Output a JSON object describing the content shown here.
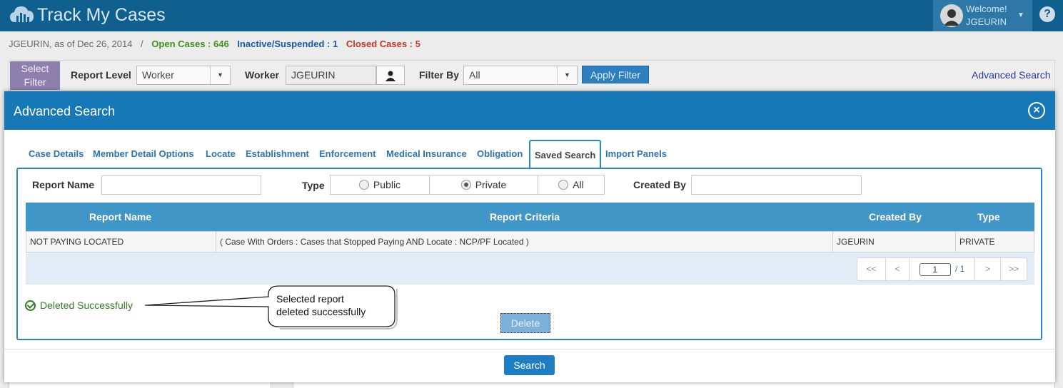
{
  "app": {
    "title": "Track My Cases"
  },
  "user": {
    "welcome": "Welcome!",
    "name": "JGEURIN"
  },
  "help_label": "?",
  "status_bar": {
    "prefix": "JGEURIN, as of Dec 26, 2014",
    "separator": "/",
    "open_cases": "Open Cases : 646",
    "inactive": "Inactive/Suspended : 1",
    "closed_cases": "Closed Cases : 5"
  },
  "filter_bar": {
    "select_filter": "Select Filter",
    "report_level_label": "Report Level",
    "report_level_value": "Worker",
    "worker_label": "Worker",
    "worker_value": "JGEURIN",
    "filter_by_label": "Filter By",
    "filter_by_value": "All",
    "apply_label": "Apply Filter",
    "advanced_link": "Advanced Search"
  },
  "modal": {
    "title": "Advanced Search",
    "tabs": [
      {
        "label": "Case Details"
      },
      {
        "label": "Member Detail Options"
      },
      {
        "label": "Locate"
      },
      {
        "label": "Establishment"
      },
      {
        "label": "Enforcement"
      },
      {
        "label": "Medical Insurance"
      },
      {
        "label": "Obligation"
      },
      {
        "label": "Saved Search",
        "active": true
      },
      {
        "label": "Import Panels"
      }
    ],
    "form": {
      "report_name_label": "Report Name",
      "report_name_value": "",
      "type_label": "Type",
      "type_options": [
        "Public",
        "Private",
        "All"
      ],
      "type_selected": "Private",
      "created_by_label": "Created By",
      "created_by_value": ""
    },
    "grid": {
      "columns": [
        "Report Name",
        "Report Criteria",
        "Created By",
        "Type"
      ],
      "rows": [
        {
          "report_name": "NOT PAYING LOCATED",
          "criteria": "( Case With Orders : Cases that Stopped Paying AND Locate : NCP/PF Located )",
          "created_by": "JGEURIN",
          "type": "PRIVATE"
        }
      ],
      "pager": {
        "first": "<<",
        "prev": "<",
        "page": "1",
        "total": "/ 1",
        "next": ">",
        "last": ">>"
      }
    },
    "message": "Deleted Successfully",
    "delete_label": "Delete",
    "search_label": "Search"
  },
  "callout": {
    "line1": "Selected report",
    "line2": "deleted successfully"
  },
  "colors": {
    "header": "#0f5f8f",
    "modal_header": "#1778b7",
    "grid_header": "#4196c8",
    "success": "#2f7d1f"
  }
}
